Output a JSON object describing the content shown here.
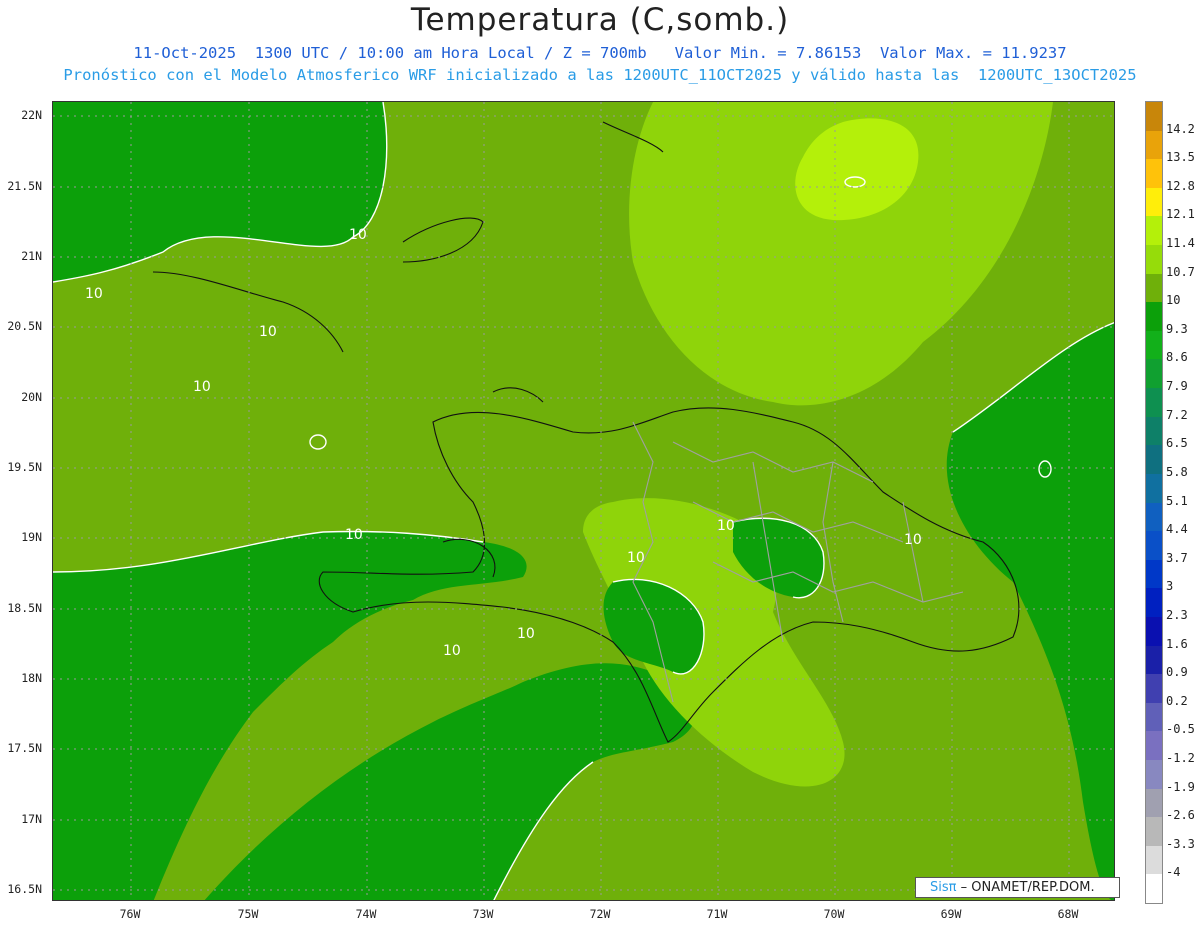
{
  "header": {
    "title": "Temperatura (C,somb.)",
    "line1": "11-Oct-2025  1300 UTC / 10:00 am Hora Local / Z = 700mb   Valor Min. = 7.86153  Valor Max. = 11.9237",
    "line2": "Pronóstico con el Modelo Atmosferico WRF inicializado a las 1200UTC_11OCT2025 y válido hasta las  1200UTC_13OCT2025"
  },
  "axes": {
    "lat_labels": [
      "22N",
      "21.5N",
      "21N",
      "20.5N",
      "20N",
      "19.5N",
      "19N",
      "18.5N",
      "18N",
      "17.5N",
      "17N",
      "16.5N"
    ],
    "lon_labels": [
      "76W",
      "75W",
      "74W",
      "73W",
      "72W",
      "71W",
      "70W",
      "69W",
      "68W"
    ]
  },
  "contour_labels": [
    "10",
    "10",
    "10",
    "10",
    "10",
    "10",
    "10",
    "10",
    "10",
    "10"
  ],
  "legend": {
    "labels": [
      "14.2",
      "13.5",
      "12.8",
      "12.1",
      "11.4",
      "10.7",
      "10",
      "9.3",
      "8.6",
      "7.9",
      "7.2",
      "6.5",
      "5.8",
      "5.1",
      "4.4",
      "3.7",
      "3",
      "2.3",
      "1.6",
      "0.9",
      "0.2",
      "-0.5",
      "-1.2",
      "-1.9",
      "-2.6",
      "-3.3",
      "-4"
    ],
    "colors": [
      "#c8860a",
      "#e9a30a",
      "#ffc20a",
      "#ffee0a",
      "#b4f00a",
      "#96dc0a",
      "#6fb00a",
      "#0ca00a",
      "#12b01a",
      "#10a030",
      "#0e9050",
      "#0e8068",
      "#0f7080",
      "#1070a0",
      "#1060c0",
      "#0a50c8",
      "#0038c8",
      "#0020c0",
      "#0a10b0",
      "#1a20a8",
      "#4040b0",
      "#6060b8",
      "#7a70c0",
      "#8888c0",
      "#a0a0b0",
      "#b8b8b8",
      "#dcdcdc",
      "#ffffff"
    ]
  },
  "credit": {
    "sis": "Sisπ",
    "text": "– ONAMET/REP.DOM."
  }
}
